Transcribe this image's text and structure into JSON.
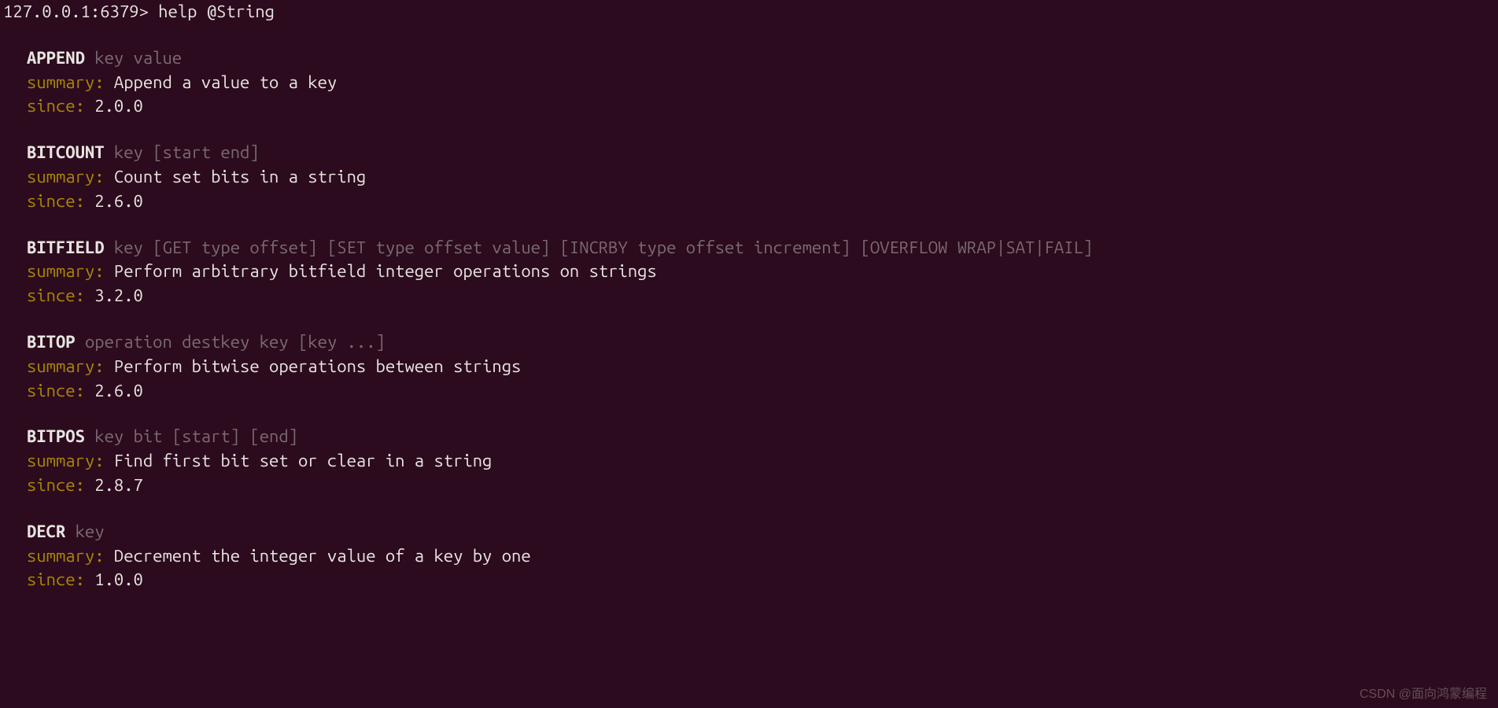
{
  "prompt": "127.0.0.1:6379>",
  "command": "help @String",
  "commands": [
    {
      "name": "APPEND",
      "args": "key value",
      "summary_label": "summary:",
      "summary": "Append a value to a key",
      "since_label": "since:",
      "since": "2.0.0"
    },
    {
      "name": "BITCOUNT",
      "args": "key [start end]",
      "summary_label": "summary:",
      "summary": "Count set bits in a string",
      "since_label": "since:",
      "since": "2.6.0"
    },
    {
      "name": "BITFIELD",
      "args": "key [GET type offset] [SET type offset value] [INCRBY type offset increment] [OVERFLOW WRAP|SAT|FAIL]",
      "summary_label": "summary:",
      "summary": "Perform arbitrary bitfield integer operations on strings",
      "since_label": "since:",
      "since": "3.2.0"
    },
    {
      "name": "BITOP",
      "args": "operation destkey key [key ...]",
      "summary_label": "summary:",
      "summary": "Perform bitwise operations between strings",
      "since_label": "since:",
      "since": "2.6.0"
    },
    {
      "name": "BITPOS",
      "args": "key bit [start] [end]",
      "summary_label": "summary:",
      "summary": "Find first bit set or clear in a string",
      "since_label": "since:",
      "since": "2.8.7"
    },
    {
      "name": "DECR",
      "args": "key",
      "summary_label": "summary:",
      "summary": "Decrement the integer value of a key by one",
      "since_label": "since:",
      "since": "1.0.0"
    }
  ],
  "watermark": "CSDN @面向鸿蒙编程"
}
